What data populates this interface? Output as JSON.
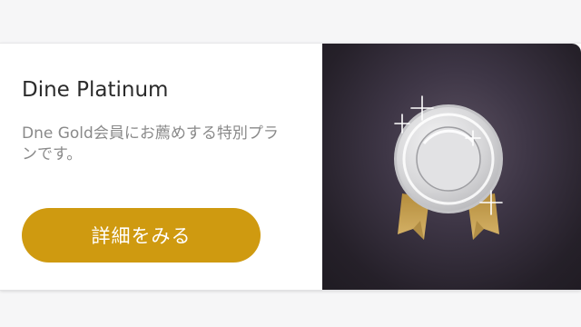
{
  "plan_card": {
    "title": "Dine Platinum",
    "description": "Dne Gold会員にお薦めする特別プランです。",
    "button_label": "詳細をみる",
    "image_icon": "platinum-medal-icon"
  },
  "colors": {
    "button": "#cf9a10",
    "image_background": "#2e2734",
    "medal": "#d9d9db",
    "ribbon": "#c9a65a"
  }
}
